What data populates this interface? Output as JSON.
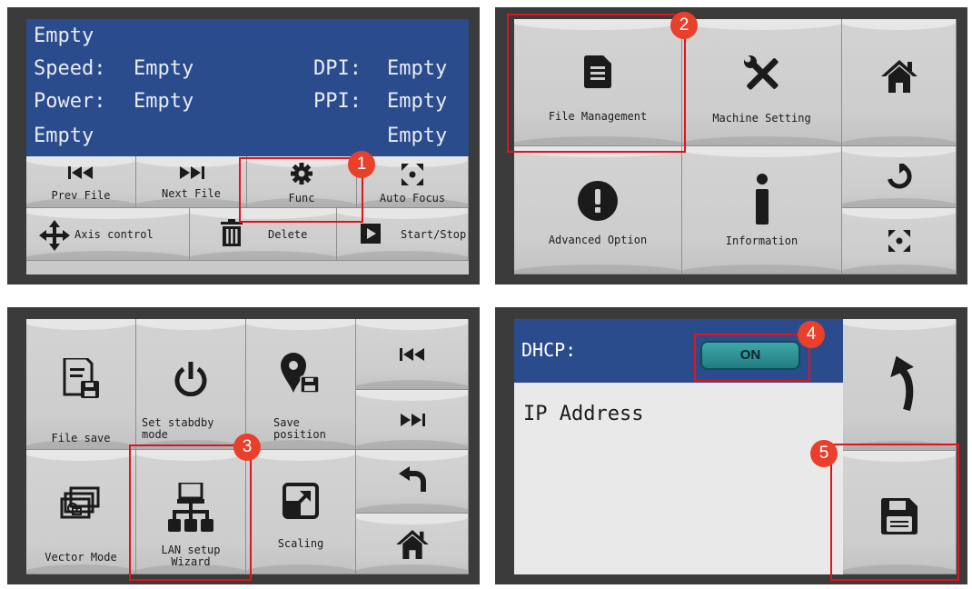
{
  "panel1": {
    "lcd": {
      "line1": "Empty",
      "speed_label": "Speed:",
      "speed_value": "Empty",
      "dpi_label": "DPI:",
      "dpi_value": "Empty",
      "power_label": "Power:",
      "power_value": "Empty",
      "ppi_label": "PPI:",
      "ppi_value": "Empty",
      "line4_left": "Empty",
      "line4_right": "Empty"
    },
    "buttons": {
      "prev_file": "Prev File",
      "next_file": "Next File",
      "func": "Func",
      "auto_focus": "Auto Focus",
      "axis_control": "Axis control",
      "delete": "Delete",
      "start_stop": "Start/Stop"
    },
    "icons": [
      "skip-back-icon",
      "skip-forward-icon",
      "gear-icon",
      "focus-icon",
      "axis-arrows-icon",
      "trash-icon",
      "play-icon"
    ]
  },
  "panel2": {
    "buttons": {
      "file_management": "File Management",
      "machine_setting": "Machine Setting",
      "advanced_option": "Advanced Option",
      "information": "Information"
    },
    "icons": [
      "document-icon",
      "wrench-screwdriver-icon",
      "home-icon",
      "exclamation-icon",
      "info-icon",
      "refresh-icon",
      "focus-icon"
    ]
  },
  "panel3": {
    "buttons": {
      "file_save": "File save",
      "set_standby": "Set stabdby\nmode",
      "save_position": "Save\nposition",
      "vector_mode": "Vector Mode",
      "lan_setup": "LAN setup\nWizard",
      "scaling": "Scaling"
    },
    "icons": [
      "file-save-icon",
      "power-icon",
      "location-save-icon",
      "vector-mode-icon",
      "network-icon",
      "scaling-icon",
      "skip-back-icon",
      "skip-forward-icon",
      "back-arrow-icon",
      "home-icon"
    ]
  },
  "panel4": {
    "dhcp_label": "DHCP:",
    "dhcp_toggle": "ON",
    "ip_label": "IP Address",
    "icons": [
      "back-arrow-icon",
      "floppy-save-icon"
    ]
  },
  "badges": [
    "1",
    "2",
    "3",
    "4",
    "5"
  ],
  "colors": {
    "lcd_blue": "#2a4b8c",
    "highlight_red": "#e0141b",
    "badge_red": "#e8402b",
    "toggle_teal": "#2a9497",
    "button_gray": "#d0d0d0",
    "bezel": "#3b3b3b"
  }
}
